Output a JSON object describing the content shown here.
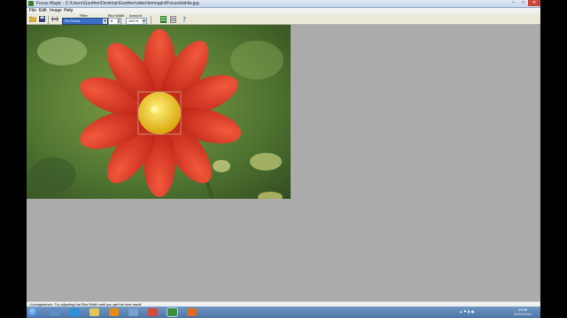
{
  "window": {
    "title": "Focus Magic - C:\\Users\\Gunther\\Desktop\\Gunther\\video\\Immagini\\Focus\\dahlia.jpg",
    "minimize": "–",
    "maximize": "□",
    "close": "✕"
  },
  "menu": {
    "items": [
      {
        "label": "File"
      },
      {
        "label": "Edit"
      },
      {
        "label": "Image"
      },
      {
        "label": "Help"
      }
    ]
  },
  "toolbar": {
    "filter_label": "Filter",
    "filter_value": "Fix Focus",
    "blur_width_label": "Blur Width",
    "blur_width_value": "8",
    "amount_label": "Amount",
    "amount_value": "100 %",
    "icons": [
      "open-folder-icon",
      "save-icon",
      "print-icon",
      "process-icon",
      "settings-icon",
      "help-icon"
    ]
  },
  "image": {
    "description_color_petals": "#d8321e",
    "description_color_center": "#f2d21c"
  },
  "status": {
    "text": "<Unregistered> Try adjusting the Blur Width until you get the best result"
  },
  "taskbar": {
    "apps": [
      "start-orb",
      "explorer",
      "internet-explorer",
      "file-manager",
      "media-player",
      "app5",
      "chrome",
      "focus-magic",
      "firefox"
    ],
    "clock_time": "20:06",
    "clock_date": "01/01/2014",
    "tray": "▲ ⚑ ▮ ◀)"
  },
  "colors": {
    "workspace_bg": "#ababab",
    "taskbar": "#4c74a6",
    "selection": "#3a6ec9"
  }
}
